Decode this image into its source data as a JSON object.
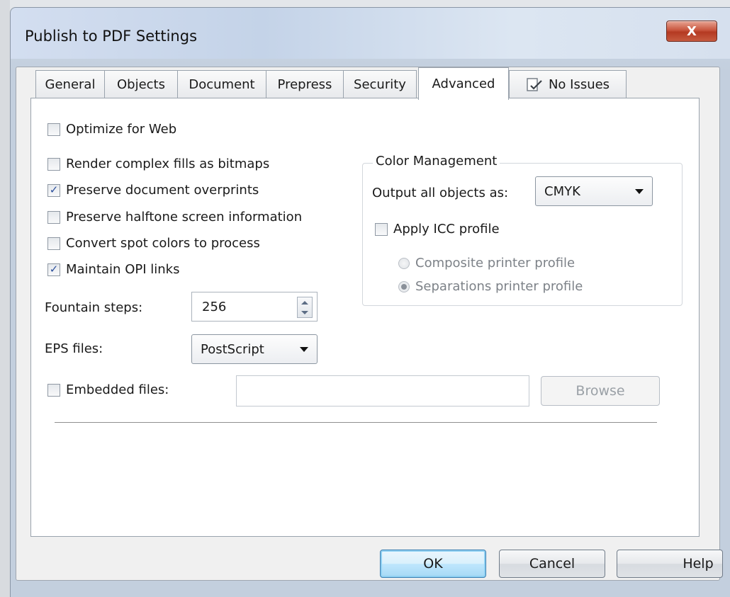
{
  "window": {
    "title": "Publish to PDF Settings",
    "close_label": "X"
  },
  "tabs": [
    {
      "label": "General",
      "active": false
    },
    {
      "label": "Objects",
      "active": false
    },
    {
      "label": "Document",
      "active": false
    },
    {
      "label": "Prepress",
      "active": false
    },
    {
      "label": "Security",
      "active": false
    },
    {
      "label": "Advanced",
      "active": true
    },
    {
      "label": "No Issues",
      "active": false,
      "icon": "check-document-icon"
    }
  ],
  "advanced": {
    "optimize_web": {
      "label": "Optimize for Web",
      "checked": false
    },
    "render_complex": {
      "label": "Render complex fills as bitmaps",
      "checked": false
    },
    "preserve_overprints": {
      "label": "Preserve document overprints",
      "checked": true
    },
    "preserve_halftone": {
      "label": "Preserve halftone screen information",
      "checked": false
    },
    "convert_spot": {
      "label": "Convert spot colors to process",
      "checked": false
    },
    "maintain_opi": {
      "label": "Maintain OPI links",
      "checked": true
    },
    "fountain_steps": {
      "label": "Fountain steps:",
      "value": "256"
    },
    "eps_files": {
      "label": "EPS files:",
      "value": "PostScript"
    },
    "embedded_files": {
      "label": "Embedded files:",
      "checked": false,
      "value": "",
      "browse_label": "Browse"
    }
  },
  "color_management": {
    "title": "Color Management",
    "output_label": "Output all objects as:",
    "output_value": "CMYK",
    "apply_icc": {
      "label": "Apply ICC profile",
      "checked": false
    },
    "composite": {
      "label": "Composite printer profile",
      "selected": false
    },
    "separations": {
      "label": "Separations printer profile",
      "selected": true
    }
  },
  "buttons": {
    "ok": "OK",
    "cancel": "Cancel",
    "help": "Help"
  },
  "colors": {
    "check_mark": "#2b4f9c",
    "close_button": "#c8553d",
    "default_button_glow": "#8fd0f2"
  }
}
